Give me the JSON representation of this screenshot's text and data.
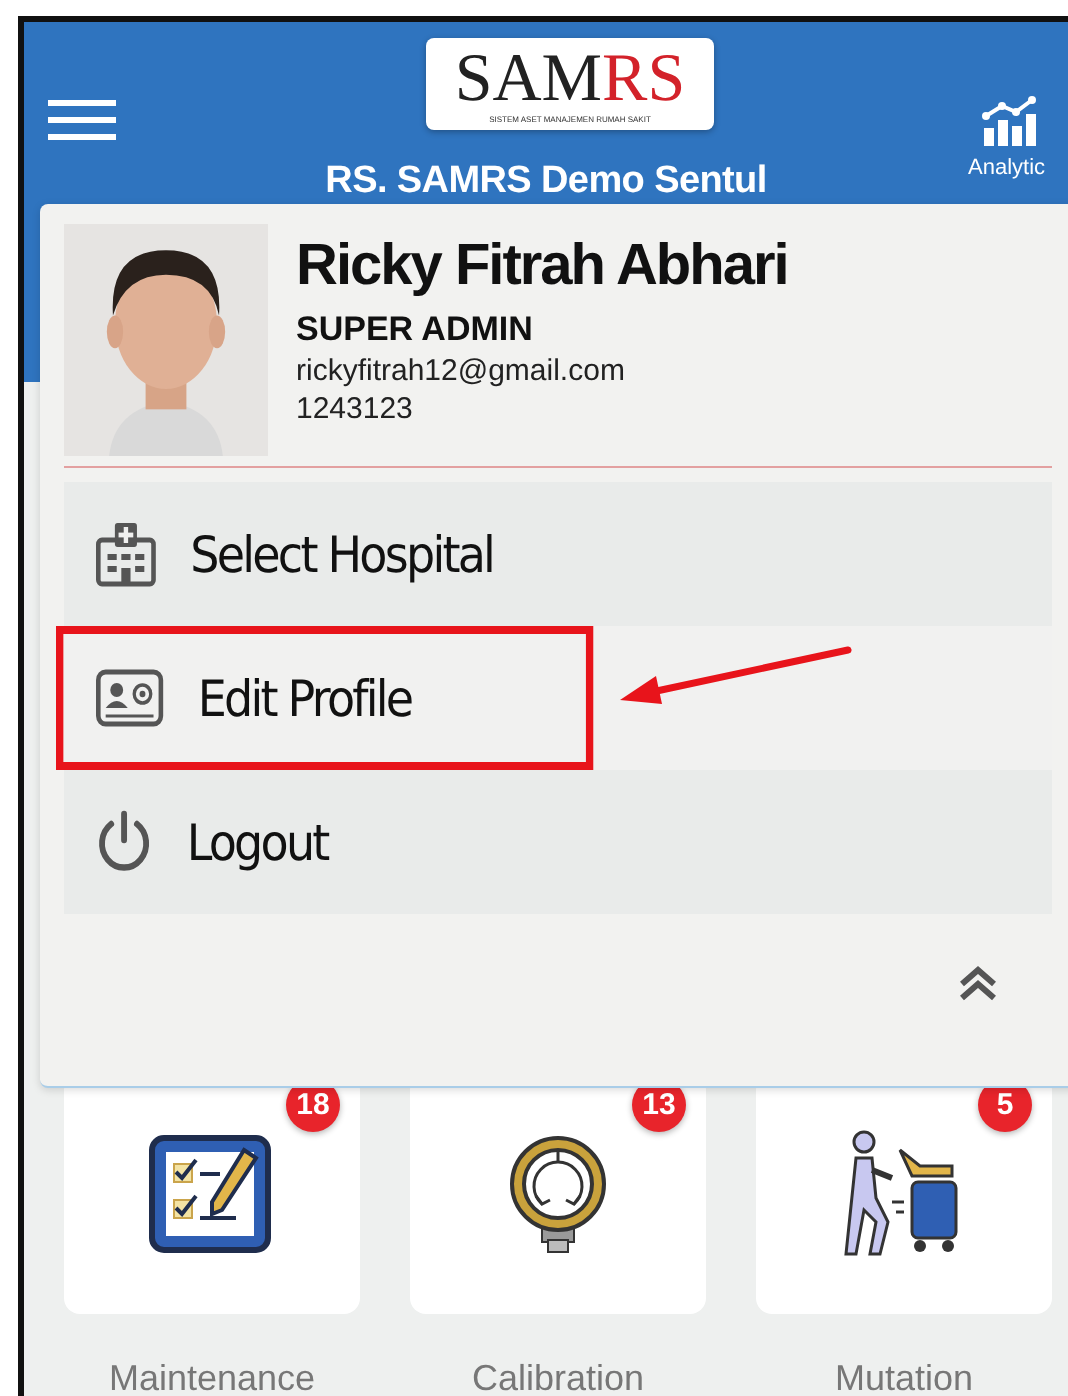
{
  "header": {
    "logo": {
      "main": "SAM",
      "accent": "RS",
      "tagline": "SISTEM ASET MANAJEMEN RUMAH SAKIT"
    },
    "hospital_name": "RS. SAMRS Demo Sentul",
    "analytics_label": "Analytic"
  },
  "profile": {
    "name": "Ricky Fitrah Abhari",
    "role": "SUPER ADMIN",
    "email": "rickyfitrah12@gmail.com",
    "phone": "1243123"
  },
  "menu": [
    {
      "kind": "hospital",
      "label": "Select Hospital",
      "highlighted": false
    },
    {
      "kind": "profile",
      "label": "Edit Profile",
      "highlighted": true
    },
    {
      "kind": "logout",
      "label": "Logout",
      "highlighted": false
    }
  ],
  "tiles": [
    {
      "kind": "maintenance",
      "label": "Maintenance",
      "badge": "18"
    },
    {
      "kind": "calibration",
      "label": "Calibration",
      "badge": "13"
    },
    {
      "kind": "mutation",
      "label": "Mutation",
      "badge": "5"
    }
  ]
}
